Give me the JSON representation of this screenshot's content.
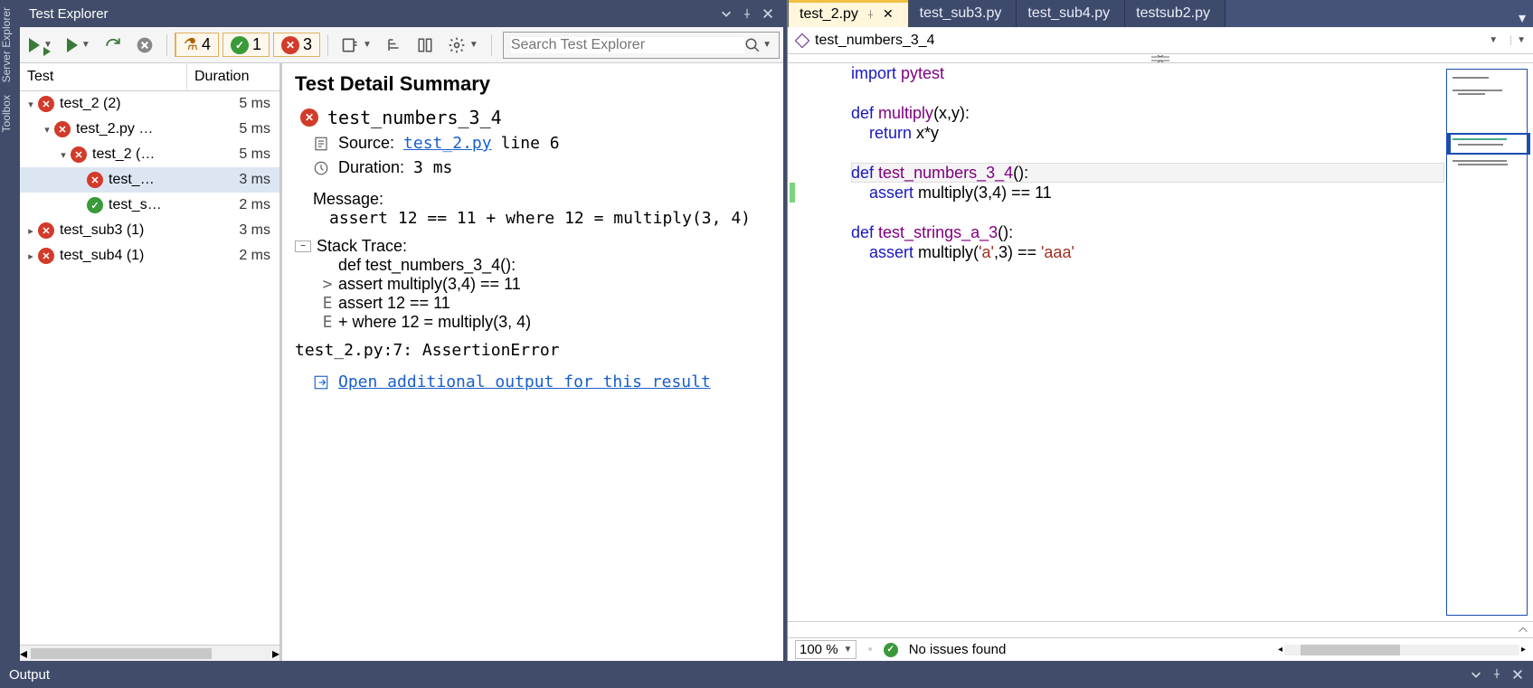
{
  "sidebar_tabs": [
    "Server Explorer",
    "Toolbox"
  ],
  "panel": {
    "title": "Test Explorer"
  },
  "summary": {
    "total": "4",
    "passed": "1",
    "failed": "3"
  },
  "search": {
    "placeholder": "Search Test Explorer"
  },
  "columns": {
    "test": "Test",
    "duration": "Duration"
  },
  "tree": [
    {
      "depth": 0,
      "expander": "▾",
      "status": "fail",
      "label": "test_2 (2)",
      "dur": "5 ms"
    },
    {
      "depth": 1,
      "expander": "▾",
      "status": "fail",
      "label": "test_2.py …",
      "dur": "5 ms"
    },
    {
      "depth": 2,
      "expander": "▾",
      "status": "fail",
      "label": "test_2 (…",
      "dur": "5 ms"
    },
    {
      "depth": 3,
      "expander": "",
      "status": "fail",
      "label": "test_…",
      "dur": "3 ms",
      "selected": true
    },
    {
      "depth": 3,
      "expander": "",
      "status": "pass",
      "label": "test_s…",
      "dur": "2 ms"
    },
    {
      "depth": 0,
      "expander": "▸",
      "status": "fail",
      "label": "test_sub3 (1)",
      "dur": "3 ms"
    },
    {
      "depth": 0,
      "expander": "▸",
      "status": "fail",
      "label": "test_sub4 (1)",
      "dur": "2 ms"
    }
  ],
  "detail": {
    "heading": "Test Detail Summary",
    "name": "test_numbers_3_4",
    "source_label": "Source:",
    "source_file": "test_2.py",
    "source_line": "line 6",
    "duration_label": "Duration:",
    "duration_value": "3 ms",
    "message_label": "Message:",
    "message_text": "assert 12 == 11  +  where 12 = multiply(3, 4)",
    "stack_label": "Stack Trace:",
    "stack": [
      {
        "g": " ",
        "t": "    def test_numbers_3_4():"
      },
      {
        "g": ">",
        "t": "        assert multiply(3,4) == 11"
      },
      {
        "g": "E",
        "t": "        assert 12 == 11"
      },
      {
        "g": "E",
        "t": "         +  where 12 = multiply(3, 4)"
      }
    ],
    "error_line": "test_2.py:7: AssertionError",
    "open_link": "Open additional output for this result"
  },
  "tabs": [
    {
      "label": "test_2.py",
      "active": true
    },
    {
      "label": "test_sub3.py"
    },
    {
      "label": "test_sub4.py"
    },
    {
      "label": "testsub2.py"
    }
  ],
  "breadcrumb": "test_numbers_3_4",
  "code_lines": [
    {
      "t": "import",
      "k": "kw",
      "r": " ",
      "t2": "pytest",
      "k2": "id"
    },
    {
      "blank": true
    },
    {
      "raw": "<span class='kw'>def</span> <span class='id'>multiply</span>(x,y):"
    },
    {
      "raw": "    <span class='kw'>return</span> x*y"
    },
    {
      "blank": true
    },
    {
      "raw": "<span class='kw'>def</span> <span class='id'>test_numbers_3_4</span>():",
      "cursor": true
    },
    {
      "raw": "    <span class='kw'>assert</span> multiply(3,4) == 11",
      "changed": true
    },
    {
      "blank": true
    },
    {
      "raw": "<span class='kw'>def</span> <span class='id'>test_strings_a_3</span>():"
    },
    {
      "raw": "    <span class='kw'>assert</span> multiply(<span class='str'>'a'</span>,3) == <span class='str'>'aaa'</span>"
    }
  ],
  "status": {
    "zoom": "100 %",
    "issues": "No issues found"
  },
  "output": {
    "label": "Output"
  }
}
